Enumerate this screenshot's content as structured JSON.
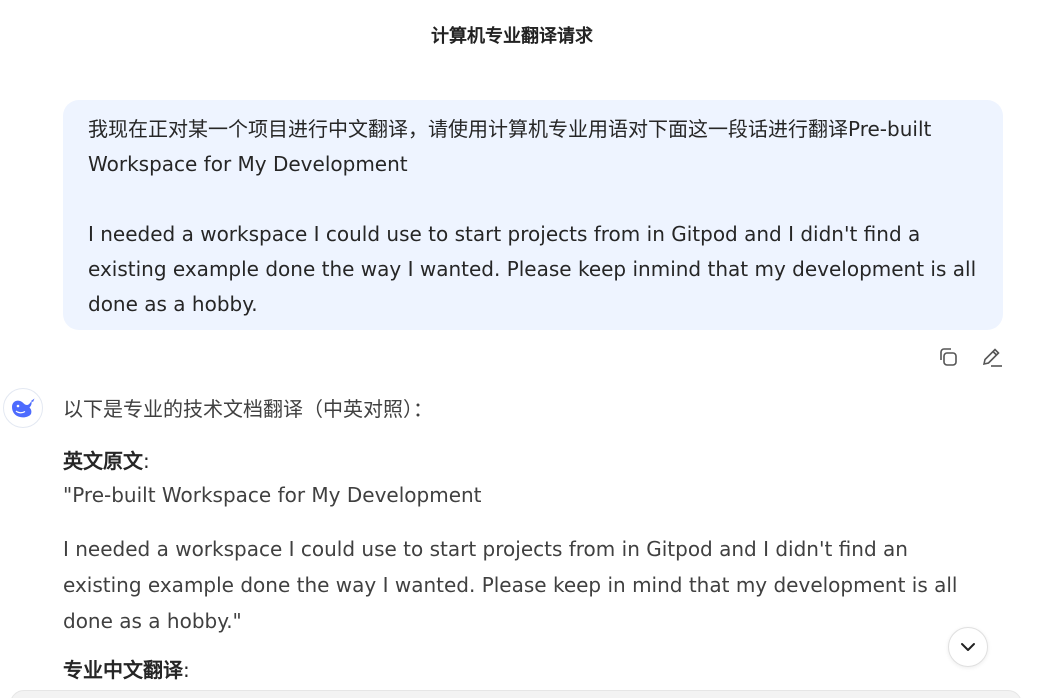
{
  "header": {
    "title": "计算机专业翻译请求"
  },
  "user_message": {
    "line1": "我现在正对某一个项目进行中文翻译，请使用计算机专业用语对下面这一段话进行翻译Pre-built",
    "line2": "Workspace for My Development",
    "paragraph": "I needed a workspace I could use to start projects from in Gitpod and I didn't find a existing example done the way I wanted. Please keep inmind that my development is all done as a hobby.",
    "actions": {
      "copy_icon": "copy-icon",
      "edit_icon": "edit-icon"
    }
  },
  "assistant": {
    "avatar_icon": "deepseek-whale-icon",
    "accent_color": "#4d6bfe",
    "intro": "以下是专业的技术文档翻译（中英对照）：",
    "original_label": "英文原文",
    "colon": ":",
    "original_title": "\"Pre-built Workspace for My Development",
    "original_paragraph": "I needed a workspace I could use to start projects from in Gitpod and I didn't find an existing example done the way I wanted. Please keep in mind that my development is all done as a hobby.\"",
    "translation_label": "专业中文翻译"
  },
  "controls": {
    "scroll_down_icon": "chevron-down-icon"
  }
}
